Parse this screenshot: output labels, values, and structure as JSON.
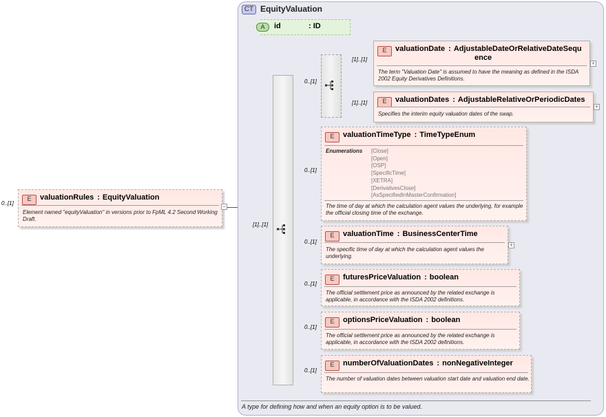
{
  "complex_type": {
    "badge": "CT",
    "name": "EquityValuation",
    "documentation": "A type for defining how and when an equity option is to be valued."
  },
  "attribute": {
    "badge": "A",
    "name": "id",
    "type": ": ID"
  },
  "root_element": {
    "badge": "E",
    "cardinality": "0..[1]",
    "name": "valuationRules",
    "type": "EquityValuation",
    "documentation": "Element named \"equityValuation\" in versions prior to FpML 4.2 Second Working Draft."
  },
  "sequence": {
    "cardinality": "[1]..[1]"
  },
  "choice": {
    "cardinality": "0..[1]"
  },
  "choice_elements": [
    {
      "badge": "E",
      "cardinality": "[1]..[1]",
      "name": "valuationDate",
      "type_line1": "AdjustableDateOrRelativeDateSequ",
      "type_line2": "ence",
      "documentation": "The term \"Valuation Date\" is assumed to have the meaning as defined in the ISDA 2002 Equity Derivatives Definitions."
    },
    {
      "badge": "E",
      "cardinality": "[1]..[1]",
      "name": "valuationDates",
      "type": "AdjustableRelativeOrPeriodicDates",
      "documentation": "Specifies the interim equity valuation dates of the swap."
    }
  ],
  "sequence_elements": [
    {
      "badge": "E",
      "cardinality": "0..[1]",
      "name": "valuationTimeType",
      "type": "TimeTypeEnum",
      "enumerations_label": "Enumerations",
      "enumerations": [
        "[Close]",
        "[Open]",
        "[OSP]",
        "[SpecificTime]",
        "[XETRA]",
        "[DerivativesClose]",
        "[AsSpecifiedInMasterConfirmation]"
      ],
      "documentation": "The time of day at which the calculation agent values the underlying, for example the official closing time of the exchange."
    },
    {
      "badge": "E",
      "cardinality": "0..[1]",
      "name": "valuationTime",
      "type": "BusinessCenterTime",
      "documentation": "The specific time of day at which the calculation agent values the underlying."
    },
    {
      "badge": "E",
      "cardinality": "0..[1]",
      "name": "futuresPriceValuation",
      "type": "boolean",
      "documentation": "The official settlement price as announced by the related exchange is applicable, in accordance with the ISDA 2002 definitions."
    },
    {
      "badge": "E",
      "cardinality": "0..[1]",
      "name": "optionsPriceValuation",
      "type": "boolean",
      "documentation": "The official settlement price as announced by the related exchange is applicable, in accordance with the ISDA 2002 definitions."
    },
    {
      "badge": "E",
      "cardinality": "0..[1]",
      "name": "numberOfValuationDates",
      "type": "nonNegativeInteger",
      "documentation": "The number of valuation dates between valuation start date and valuation end date."
    }
  ],
  "glyphs": {
    "colon": ":",
    "plus": "+",
    "minus": "−"
  },
  "icons": [
    "sequence-compositor-icon",
    "choice-compositor-icon",
    "expand-icon",
    "collapse-icon"
  ],
  "colors": {
    "element_fill": "#ffe8e4",
    "complex_type_fill": "#e9e9f1",
    "attribute_fill": "#e4f4dc",
    "compositor_fill": "#eeeeee"
  }
}
